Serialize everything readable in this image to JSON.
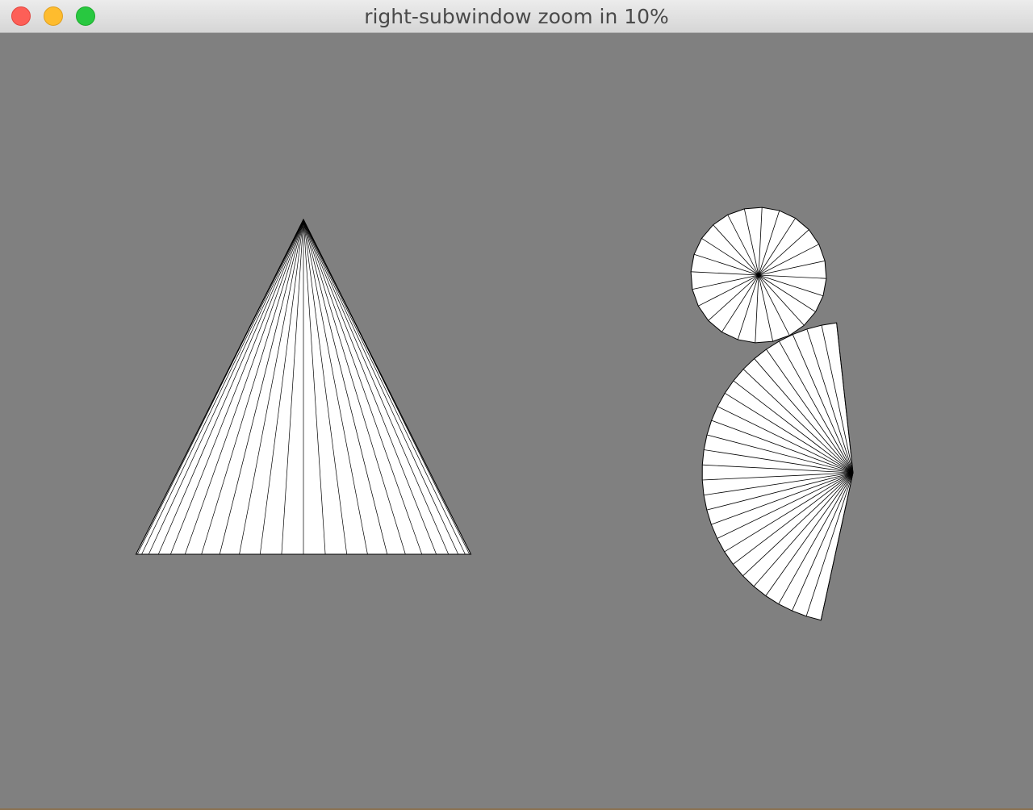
{
  "window": {
    "title": "right-subwindow zoom in 10%"
  },
  "controls": {
    "close_icon": "close-icon",
    "minimize_icon": "minimize-icon",
    "zoom_icon": "zoom-icon"
  },
  "colors": {
    "canvas_background": "#808080",
    "shape_fill": "#ffffff",
    "shape_stroke": "#000000",
    "close": "#fd5f57",
    "minimize": "#febc2e",
    "zoom": "#28c840"
  }
}
